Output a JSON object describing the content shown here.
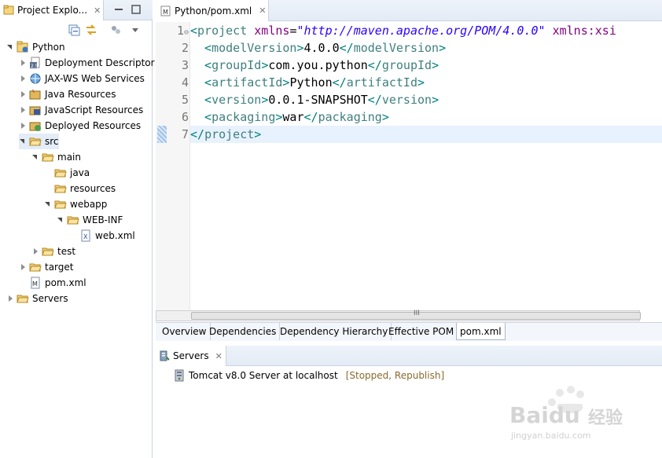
{
  "explorer": {
    "tab_title": "Project Explo...",
    "tree": [
      {
        "label": "Python",
        "indent": 0,
        "state": "open",
        "icon": "project-icon"
      },
      {
        "label": "Deployment Descriptor",
        "indent": 1,
        "state": "closed",
        "icon": "deployment-descriptor-icon"
      },
      {
        "label": "JAX-WS Web Services",
        "indent": 1,
        "state": "closed",
        "icon": "web-services-icon"
      },
      {
        "label": "Java Resources",
        "indent": 1,
        "state": "closed",
        "icon": "java-resources-icon"
      },
      {
        "label": "JavaScript Resources",
        "indent": 1,
        "state": "closed",
        "icon": "javascript-resources-icon"
      },
      {
        "label": "Deployed Resources",
        "indent": 1,
        "state": "closed",
        "icon": "deployed-resources-icon"
      },
      {
        "label": "src",
        "indent": 1,
        "state": "open",
        "icon": "folder-icon",
        "selected": true
      },
      {
        "label": "main",
        "indent": 2,
        "state": "open",
        "icon": "folder-icon"
      },
      {
        "label": "java",
        "indent": 3,
        "state": "none",
        "icon": "folder-icon"
      },
      {
        "label": "resources",
        "indent": 3,
        "state": "none",
        "icon": "folder-icon"
      },
      {
        "label": "webapp",
        "indent": 3,
        "state": "open",
        "icon": "folder-icon"
      },
      {
        "label": "WEB-INF",
        "indent": 4,
        "state": "open",
        "icon": "folder-icon"
      },
      {
        "label": "web.xml",
        "indent": 5,
        "state": "none",
        "icon": "xml-file-icon"
      },
      {
        "label": "test",
        "indent": 2,
        "state": "closed",
        "icon": "folder-icon"
      },
      {
        "label": "target",
        "indent": 1,
        "state": "closed",
        "icon": "folder-icon"
      },
      {
        "label": "pom.xml",
        "indent": 1,
        "state": "none",
        "icon": "maven-file-icon"
      },
      {
        "label": "Servers",
        "indent": 0,
        "state": "closed",
        "icon": "folder-icon"
      }
    ]
  },
  "editor": {
    "tab_title": "Python/pom.xml",
    "lines": [
      {
        "no": "1",
        "fold": "⊖",
        "segments": [
          {
            "t": "<",
            "c": "bracket"
          },
          {
            "t": "project",
            "c": "tag"
          },
          {
            "t": " ",
            "c": ""
          },
          {
            "t": "xmlns",
            "c": "attr"
          },
          {
            "t": "=",
            "c": ""
          },
          {
            "t": "\"http://maven.apache.org/POM/4.0.0\"",
            "c": "str"
          },
          {
            "t": " ",
            "c": ""
          },
          {
            "t": "xmlns:xsi",
            "c": "attr"
          }
        ]
      },
      {
        "no": "2",
        "fold": "",
        "segments": [
          {
            "t": "  <",
            "c": "bracket"
          },
          {
            "t": "modelVersion",
            "c": "tag"
          },
          {
            "t": ">",
            "c": "bracket"
          },
          {
            "t": "4.0.0",
            "c": ""
          },
          {
            "t": "</",
            "c": "bracket"
          },
          {
            "t": "modelVersion",
            "c": "tag"
          },
          {
            "t": ">",
            "c": "bracket"
          }
        ]
      },
      {
        "no": "3",
        "fold": "",
        "segments": [
          {
            "t": "  <",
            "c": "bracket"
          },
          {
            "t": "groupId",
            "c": "tag"
          },
          {
            "t": ">",
            "c": "bracket"
          },
          {
            "t": "com.you.python",
            "c": ""
          },
          {
            "t": "</",
            "c": "bracket"
          },
          {
            "t": "groupId",
            "c": "tag"
          },
          {
            "t": ">",
            "c": "bracket"
          }
        ]
      },
      {
        "no": "4",
        "fold": "",
        "segments": [
          {
            "t": "  <",
            "c": "bracket"
          },
          {
            "t": "artifactId",
            "c": "tag"
          },
          {
            "t": ">",
            "c": "bracket"
          },
          {
            "t": "Python",
            "c": ""
          },
          {
            "t": "</",
            "c": "bracket"
          },
          {
            "t": "artifactId",
            "c": "tag"
          },
          {
            "t": ">",
            "c": "bracket"
          }
        ]
      },
      {
        "no": "5",
        "fold": "",
        "segments": [
          {
            "t": "  <",
            "c": "bracket"
          },
          {
            "t": "version",
            "c": "tag"
          },
          {
            "t": ">",
            "c": "bracket"
          },
          {
            "t": "0.0.1-SNAPSHOT",
            "c": ""
          },
          {
            "t": "</",
            "c": "bracket"
          },
          {
            "t": "version",
            "c": "tag"
          },
          {
            "t": ">",
            "c": "bracket"
          }
        ]
      },
      {
        "no": "6",
        "fold": "",
        "segments": [
          {
            "t": "  <",
            "c": "bracket"
          },
          {
            "t": "packaging",
            "c": "tag"
          },
          {
            "t": ">",
            "c": "bracket"
          },
          {
            "t": "war",
            "c": ""
          },
          {
            "t": "</",
            "c": "bracket"
          },
          {
            "t": "packaging",
            "c": "tag"
          },
          {
            "t": ">",
            "c": "bracket"
          }
        ]
      },
      {
        "no": "7",
        "fold": "",
        "current": true,
        "segments": [
          {
            "t": "</",
            "c": "bracket"
          },
          {
            "t": "project",
            "c": "tag"
          },
          {
            "t": ">",
            "c": "bracket"
          }
        ]
      }
    ],
    "bottom_tabs": [
      "Overview",
      "Dependencies",
      "Dependency Hierarchy",
      "Effective POM",
      "pom.xml"
    ],
    "active_bottom_tab": "pom.xml",
    "scroll_thumb": "III"
  },
  "servers": {
    "tab_title": "Servers",
    "server_name": "Tomcat v8.0 Server at localhost",
    "server_status": "[Stopped, Republish]"
  },
  "watermark": {
    "brand": "Baidu",
    "brand_cn": "经验",
    "url": "jingyan.baidu.com"
  },
  "colors": {
    "tag": "#3f7f7f",
    "attr": "#7f007f",
    "string": "#2a00ff",
    "status": "#8b6a2b",
    "current_line": "#e8f2fe"
  }
}
